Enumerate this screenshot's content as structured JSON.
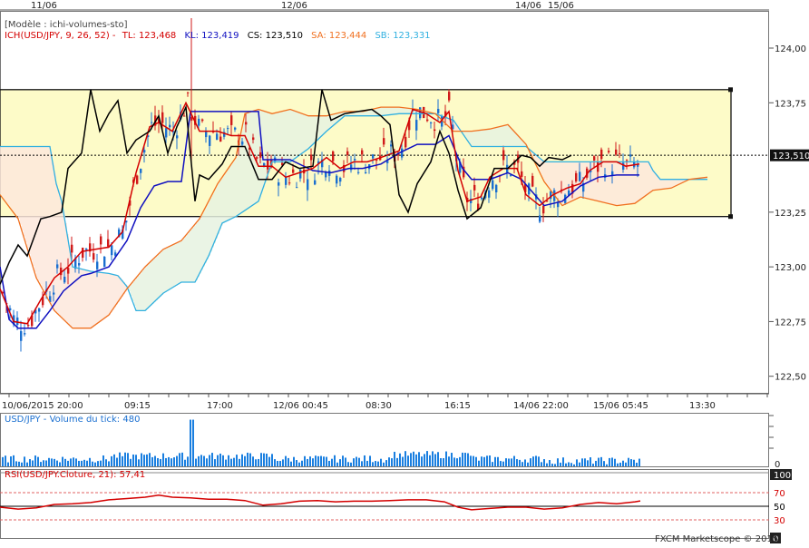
{
  "model_label": "[Modèle : ichi-volumes-sto]",
  "legend": {
    "parts": [
      {
        "text": "ICH(USD/JPY, 9, 26, 52) -",
        "color": "#d40000"
      },
      {
        "text": "TL: 123,468",
        "color": "#d40000"
      },
      {
        "text": "KL: 123,419",
        "color": "#1010c0"
      },
      {
        "text": "CS: 123,510",
        "color": "#000000"
      },
      {
        "text": "SA: 123,444",
        "color": "#f07020"
      },
      {
        "text": "SB: 123,331",
        "color": "#30b0e0"
      }
    ]
  },
  "top_dates": [
    "11/06",
    "12/06",
    "14/06",
    "15/06"
  ],
  "x_tick_labels": [
    "10/06/2015 20:00",
    "09:15",
    "17:00",
    "12/06 00:45",
    "08:30",
    "16:15",
    "14/06 22:00",
    "15/06 05:45",
    "13:30"
  ],
  "y_tick_labels": [
    "124,00",
    "123,75",
    "123,50",
    "123,25",
    "123,00",
    "122,75",
    "122,50"
  ],
  "current_price": "123,510",
  "volume_panel": {
    "title": "USD/JPY - Volume du tick: 480",
    "axis_zero": "0"
  },
  "rsi_panel": {
    "title": "RSI(USD/JPY.Cloture, 21): 57,41",
    "axis_labels": [
      "100",
      "70",
      "50",
      "30",
      "0"
    ]
  },
  "copyright": "FXCM Marketscope © 2015",
  "colors": {
    "tenkan": "#d40000",
    "kijun": "#1010c0",
    "chikou": "#000000",
    "span_a": "#f07020",
    "span_b": "#30b0e0",
    "candle_up": "#1a6fd0",
    "candle_down": "#d01a1a",
    "box_fill": "#fdfbc8",
    "volume": "#1a7fe0",
    "rsi": "#d40000"
  },
  "chart_data": {
    "type": "line",
    "title": "ICH(USD/JPY, 9, 26, 52)",
    "ylabel": "",
    "ylim": [
      122.42,
      124.17
    ],
    "x_categories": [
      "10/06/2015 20:00",
      "09:15",
      "17:00",
      "12/06 00:45",
      "08:30",
      "16:15",
      "14/06 22:00",
      "15/06 05:45",
      "13:30"
    ],
    "range_box": {
      "upper": 123.81,
      "lower": 123.23
    },
    "last_close": 123.51,
    "series": [
      {
        "name": "TL",
        "last": 123.468
      },
      {
        "name": "KL",
        "last": 123.419
      },
      {
        "name": "CS",
        "last": 123.51
      },
      {
        "name": "SA",
        "last": 123.444
      },
      {
        "name": "SB",
        "last": 123.331
      }
    ],
    "volume": {
      "last": 480,
      "max": 1050
    },
    "rsi": {
      "last": 57.41,
      "levels": [
        30,
        50,
        70
      ]
    }
  }
}
